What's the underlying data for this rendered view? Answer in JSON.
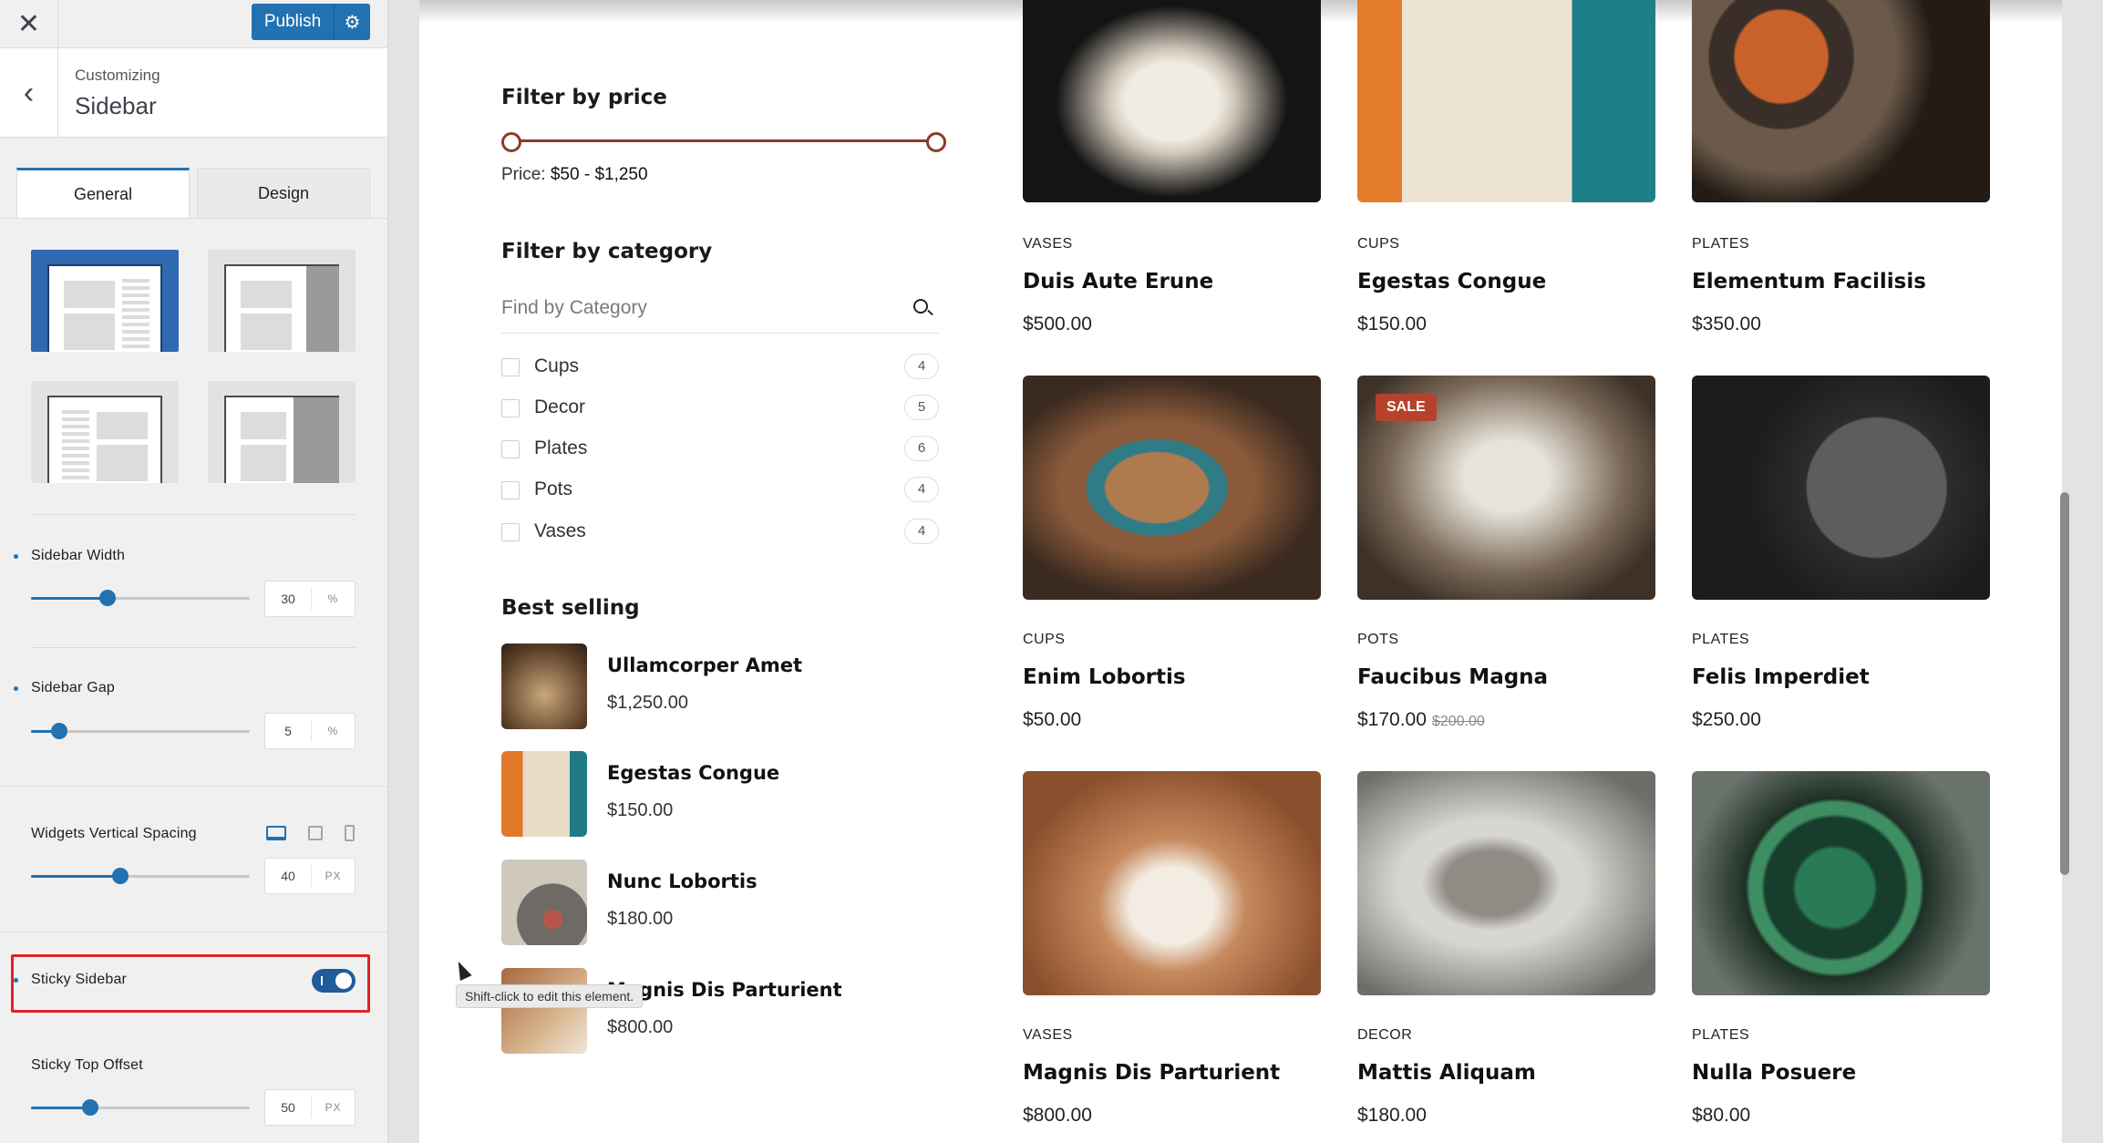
{
  "topbar": {
    "publish_label": "Publish"
  },
  "section": {
    "small": "Customizing",
    "title": "Sidebar"
  },
  "tabs": [
    {
      "label": "General"
    },
    {
      "label": "Design"
    }
  ],
  "controls": {
    "sidebar_width": {
      "label": "Sidebar Width",
      "value": "30",
      "unit": "%",
      "fraction": 0.35
    },
    "sidebar_gap": {
      "label": "Sidebar Gap",
      "value": "5",
      "unit": "%",
      "fraction": 0.13
    },
    "widgets_spacing": {
      "label": "Widgets Vertical Spacing",
      "value": "40",
      "unit": "PX",
      "fraction": 0.41
    },
    "sticky_sidebar": {
      "label": "Sticky Sidebar",
      "enabled": true
    },
    "sticky_offset": {
      "label": "Sticky Top Offset",
      "value": "50",
      "unit": "PX",
      "fraction": 0.27
    }
  },
  "filters": {
    "price_title": "Filter by price",
    "price_prefix": "Price:",
    "price_value": "$50 - $1,250",
    "category_title": "Filter by category",
    "category_placeholder": "Find by Category",
    "categories": [
      {
        "name": "Cups",
        "count": "4"
      },
      {
        "name": "Decor",
        "count": "5"
      },
      {
        "name": "Plates",
        "count": "6"
      },
      {
        "name": "Pots",
        "count": "4"
      },
      {
        "name": "Vases",
        "count": "4"
      }
    ],
    "best_title": "Best selling",
    "best_selling": [
      {
        "name": "Ullamcorper Amet",
        "price": "$1,250.00"
      },
      {
        "name": "Egestas Congue",
        "price": "$150.00"
      },
      {
        "name": "Nunc Lobortis",
        "price": "$180.00"
      },
      {
        "name": "Magnis Dis Parturient",
        "price": "$800.00"
      }
    ]
  },
  "products": [
    {
      "category": "VASES",
      "name": "Duis Aute Erune",
      "price": "$500.00",
      "old_price": ""
    },
    {
      "category": "CUPS",
      "name": "Egestas Congue",
      "price": "$150.00",
      "old_price": ""
    },
    {
      "category": "PLATES",
      "name": "Elementum Facilisis",
      "price": "$350.00",
      "old_price": ""
    },
    {
      "category": "CUPS",
      "name": "Enim Lobortis",
      "price": "$50.00",
      "old_price": ""
    },
    {
      "category": "POTS",
      "name": "Faucibus Magna",
      "price": "$170.00",
      "old_price": "$200.00",
      "badge": "SALE"
    },
    {
      "category": "PLATES",
      "name": "Felis Imperdiet",
      "price": "$250.00",
      "old_price": ""
    },
    {
      "category": "VASES",
      "name": "Magnis Dis Parturient",
      "price": "$800.00",
      "old_price": ""
    },
    {
      "category": "DECOR",
      "name": "Mattis Aliquam",
      "price": "$180.00",
      "old_price": ""
    },
    {
      "category": "PLATES",
      "name": "Nulla Posuere",
      "price": "$80.00",
      "old_price": ""
    }
  ],
  "tooltip": "Shift-click to edit this element.",
  "colors": {
    "accent": "#2271b1",
    "price_slider": "#8e3b2a",
    "sale_badge": "#b5432c",
    "highlight": "#e02424"
  },
  "icons": [
    "close-icon",
    "gear-icon",
    "back-arrow-icon",
    "search-icon",
    "desktop-icon",
    "tablet-icon",
    "mobile-icon"
  ]
}
